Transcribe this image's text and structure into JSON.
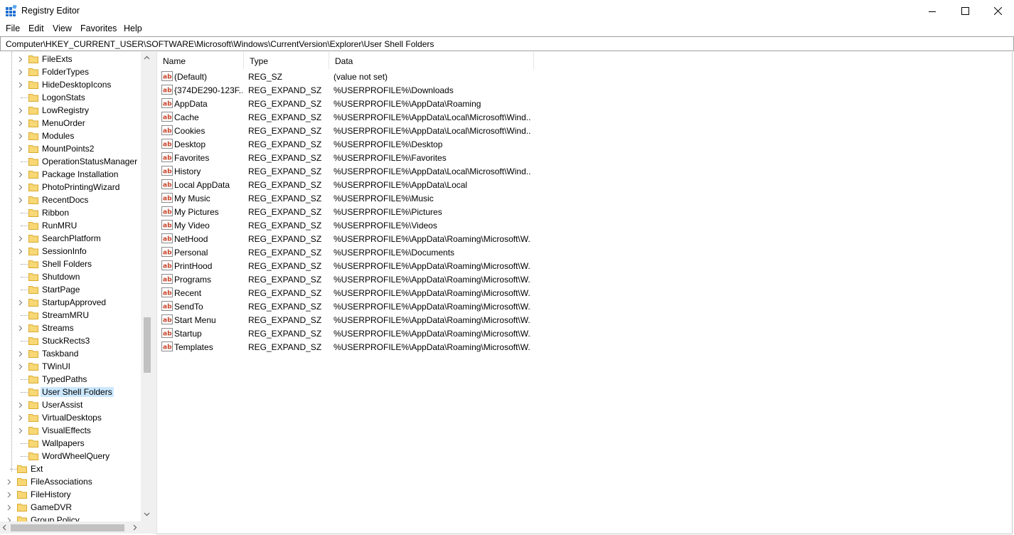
{
  "window": {
    "title": "Registry Editor",
    "icon": "registry-icon",
    "controls": [
      "minimize-icon",
      "maximize-icon",
      "close-icon"
    ]
  },
  "menu": [
    "File",
    "Edit",
    "View",
    "Favorites",
    "Help"
  ],
  "address": "Computer\\HKEY_CURRENT_USER\\SOFTWARE\\Microsoft\\Windows\\CurrentVersion\\Explorer\\User Shell Folders",
  "tree": {
    "items": [
      {
        "label": "FileExts",
        "expandable": true
      },
      {
        "label": "FolderTypes",
        "expandable": true
      },
      {
        "label": "HideDesktopIcons",
        "expandable": true
      },
      {
        "label": "LogonStats",
        "expandable": false
      },
      {
        "label": "LowRegistry",
        "expandable": true
      },
      {
        "label": "MenuOrder",
        "expandable": true
      },
      {
        "label": "Modules",
        "expandable": true
      },
      {
        "label": "MountPoints2",
        "expandable": true
      },
      {
        "label": "OperationStatusManager",
        "expandable": false
      },
      {
        "label": "Package Installation",
        "expandable": true
      },
      {
        "label": "PhotoPrintingWizard",
        "expandable": true
      },
      {
        "label": "RecentDocs",
        "expandable": true
      },
      {
        "label": "Ribbon",
        "expandable": false
      },
      {
        "label": "RunMRU",
        "expandable": false
      },
      {
        "label": "SearchPlatform",
        "expandable": true
      },
      {
        "label": "SessionInfo",
        "expandable": true
      },
      {
        "label": "Shell Folders",
        "expandable": false
      },
      {
        "label": "Shutdown",
        "expandable": false
      },
      {
        "label": "StartPage",
        "expandable": false
      },
      {
        "label": "StartupApproved",
        "expandable": true
      },
      {
        "label": "StreamMRU",
        "expandable": false
      },
      {
        "label": "Streams",
        "expandable": true
      },
      {
        "label": "StuckRects3",
        "expandable": false
      },
      {
        "label": "Taskband",
        "expandable": true
      },
      {
        "label": "TWinUI",
        "expandable": true
      },
      {
        "label": "TypedPaths",
        "expandable": false
      },
      {
        "label": "User Shell Folders",
        "expandable": false,
        "selected": true
      },
      {
        "label": "UserAssist",
        "expandable": true
      },
      {
        "label": "VirtualDesktops",
        "expandable": true
      },
      {
        "label": "VisualEffects",
        "expandable": true
      },
      {
        "label": "Wallpapers",
        "expandable": false
      },
      {
        "label": "WordWheelQuery",
        "expandable": false
      }
    ],
    "parent_items": [
      {
        "label": "Ext",
        "expandable": false
      },
      {
        "label": "FileAssociations",
        "expandable": true
      },
      {
        "label": "FileHistory",
        "expandable": true
      },
      {
        "label": "GameDVR",
        "expandable": true
      },
      {
        "label": "Group Policy",
        "expandable": true
      }
    ]
  },
  "list": {
    "columns": [
      "Name",
      "Type",
      "Data"
    ],
    "rows": [
      {
        "name": "(Default)",
        "type": "REG_SZ",
        "data": "(value not set)"
      },
      {
        "name": "{374DE290-123F...",
        "type": "REG_EXPAND_SZ",
        "data": "%USERPROFILE%\\Downloads"
      },
      {
        "name": "AppData",
        "type": "REG_EXPAND_SZ",
        "data": "%USERPROFILE%\\AppData\\Roaming"
      },
      {
        "name": "Cache",
        "type": "REG_EXPAND_SZ",
        "data": "%USERPROFILE%\\AppData\\Local\\Microsoft\\Wind..."
      },
      {
        "name": "Cookies",
        "type": "REG_EXPAND_SZ",
        "data": "%USERPROFILE%\\AppData\\Local\\Microsoft\\Wind..."
      },
      {
        "name": "Desktop",
        "type": "REG_EXPAND_SZ",
        "data": "%USERPROFILE%\\Desktop"
      },
      {
        "name": "Favorites",
        "type": "REG_EXPAND_SZ",
        "data": "%USERPROFILE%\\Favorites"
      },
      {
        "name": "History",
        "type": "REG_EXPAND_SZ",
        "data": "%USERPROFILE%\\AppData\\Local\\Microsoft\\Wind..."
      },
      {
        "name": "Local AppData",
        "type": "REG_EXPAND_SZ",
        "data": "%USERPROFILE%\\AppData\\Local"
      },
      {
        "name": "My Music",
        "type": "REG_EXPAND_SZ",
        "data": "%USERPROFILE%\\Music"
      },
      {
        "name": "My Pictures",
        "type": "REG_EXPAND_SZ",
        "data": "%USERPROFILE%\\Pictures"
      },
      {
        "name": "My Video",
        "type": "REG_EXPAND_SZ",
        "data": "%USERPROFILE%\\Videos"
      },
      {
        "name": "NetHood",
        "type": "REG_EXPAND_SZ",
        "data": "%USERPROFILE%\\AppData\\Roaming\\Microsoft\\W..."
      },
      {
        "name": "Personal",
        "type": "REG_EXPAND_SZ",
        "data": "%USERPROFILE%\\Documents"
      },
      {
        "name": "PrintHood",
        "type": "REG_EXPAND_SZ",
        "data": "%USERPROFILE%\\AppData\\Roaming\\Microsoft\\W..."
      },
      {
        "name": "Programs",
        "type": "REG_EXPAND_SZ",
        "data": "%USERPROFILE%\\AppData\\Roaming\\Microsoft\\W..."
      },
      {
        "name": "Recent",
        "type": "REG_EXPAND_SZ",
        "data": "%USERPROFILE%\\AppData\\Roaming\\Microsoft\\W..."
      },
      {
        "name": "SendTo",
        "type": "REG_EXPAND_SZ",
        "data": "%USERPROFILE%\\AppData\\Roaming\\Microsoft\\W..."
      },
      {
        "name": "Start Menu",
        "type": "REG_EXPAND_SZ",
        "data": "%USERPROFILE%\\AppData\\Roaming\\Microsoft\\W..."
      },
      {
        "name": "Startup",
        "type": "REG_EXPAND_SZ",
        "data": "%USERPROFILE%\\AppData\\Roaming\\Microsoft\\W..."
      },
      {
        "name": "Templates",
        "type": "REG_EXPAND_SZ",
        "data": "%USERPROFILE%\\AppData\\Roaming\\Microsoft\\W..."
      }
    ]
  },
  "colors": {
    "selection": "#cce8ff",
    "folder": "#f8d775",
    "folder_edge": "#d9aa2e",
    "string_icon_red": "#c8442b"
  }
}
